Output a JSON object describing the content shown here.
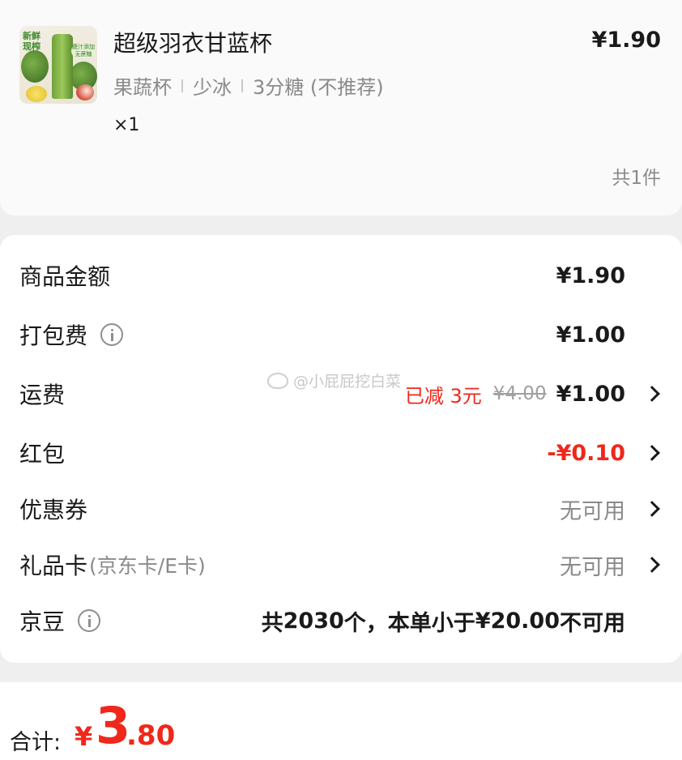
{
  "product": {
    "thumb_tag": "新鲜现榨",
    "thumb_label": "蔬汁添加 无蔗糖",
    "name": "超级羽衣甘蓝杯",
    "price": "¥1.90",
    "specs": [
      "果蔬杯",
      "少冰",
      "3分糖 (不推荐)"
    ],
    "quantity": "×1",
    "total_count": "共1件"
  },
  "fees": {
    "goods_amount": {
      "label": "商品金额",
      "value": "¥1.90"
    },
    "packing_fee": {
      "label": "打包费",
      "value": "¥1.00"
    },
    "shipping": {
      "label": "运费",
      "discount": "已减 3元",
      "original": "¥4.00",
      "value": "¥1.00"
    },
    "red_packet": {
      "label": "红包",
      "value": "-¥0.10"
    },
    "coupon": {
      "label": "优惠券",
      "value": "无可用"
    },
    "gift_card": {
      "label": "礼品卡",
      "sub": "(京东卡/E卡)",
      "value": "无可用"
    },
    "jd_beans": {
      "label": "京豆",
      "prefix": "共",
      "count": "2030",
      "middle": "个，本单小于",
      "threshold": "¥20.00",
      "suffix": "不可用"
    }
  },
  "watermark": "@小屁屁挖白菜",
  "footer": {
    "total_label": "合计:",
    "currency": "¥",
    "integer": "3",
    "decimal": ".80"
  },
  "colors": {
    "accent_red": "#f0271b",
    "gray_text": "#8a8a8a",
    "background": "#efefef"
  }
}
